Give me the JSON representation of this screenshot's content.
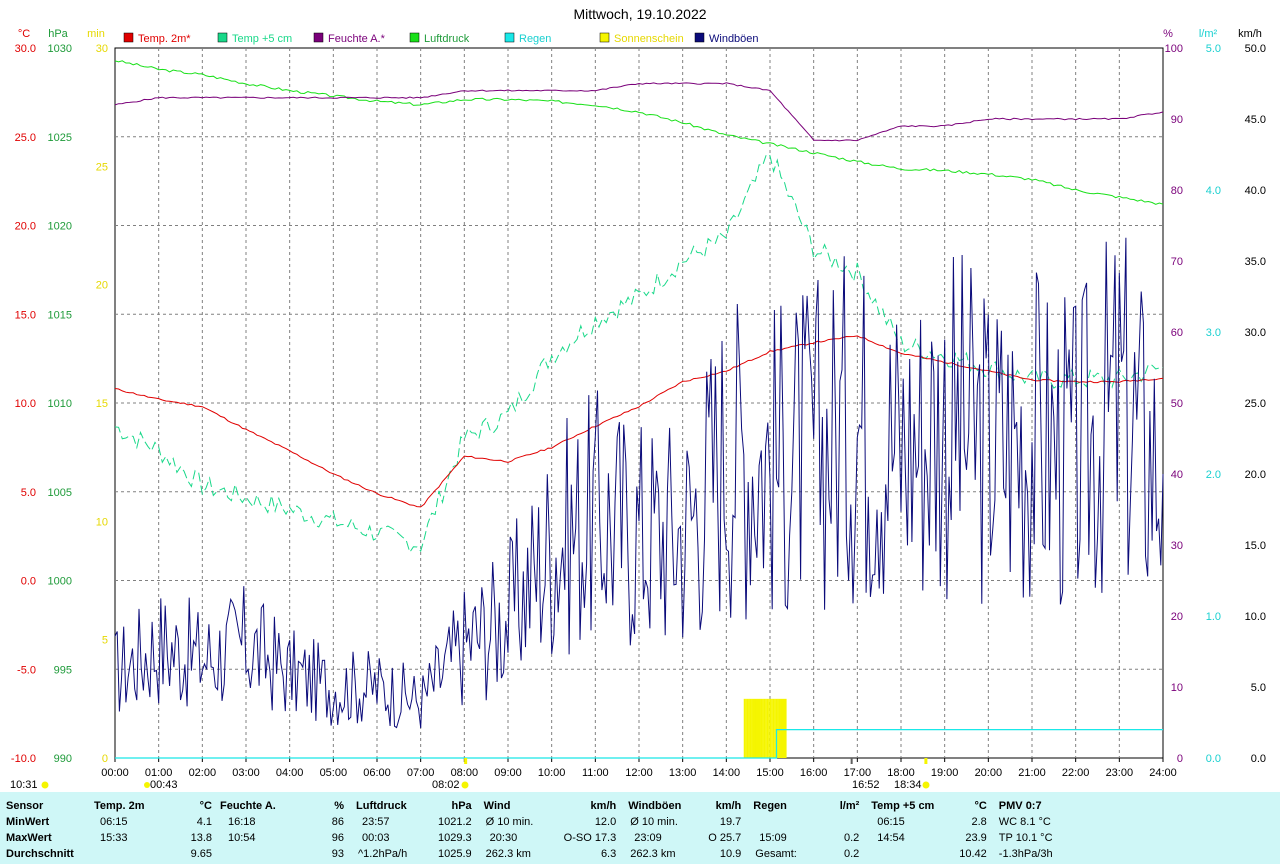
{
  "title": "Mittwoch, 19.10.2022",
  "colors": {
    "temp2m": "#e00000",
    "temp5cm": "#19d889",
    "humidity": "#7a007a",
    "pressure": "#19e019",
    "rain": "#19e8e8",
    "sun": "#f5f500",
    "gusts": "#0b0b7a",
    "grid": "#808080",
    "pressure_label": "#1f9b3a",
    "sun_label": "#e6d800",
    "humidity_label": "#7a007a",
    "rain_label": "#19d0d0"
  },
  "legend": [
    {
      "label": "Temp. 2m*",
      "color": "#e00000"
    },
    {
      "label": "Temp +5 cm",
      "color": "#19d889"
    },
    {
      "label": "Feuchte A.*",
      "color": "#7a007a"
    },
    {
      "label": "Luftdruck",
      "color": "#19e019"
    },
    {
      "label": "Regen",
      "color": "#19e8e8"
    },
    {
      "label": "Sonnenschein",
      "color": "#f5f500"
    },
    {
      "label": "Windböen",
      "color": "#0b0b7a"
    }
  ],
  "axes": {
    "temp_unit": "°C",
    "pressure_unit": "hPa",
    "sun_unit": "min",
    "humidity_unit": "%",
    "rain_unit": "l/m²",
    "wind_unit": "km/h",
    "temp_ticks": [
      "30.0",
      "25.0",
      "20.0",
      "15.0",
      "10.0",
      "5.0",
      "0.0",
      "-5.0",
      "-10.0"
    ],
    "pressure_ticks": [
      "1030",
      "1025",
      "1020",
      "1015",
      "1010",
      "1005",
      "1000",
      "995",
      "990"
    ],
    "sun_ticks": [
      "30",
      "25",
      "20",
      "15",
      "10",
      "5",
      "0"
    ],
    "humidity_ticks": [
      "100",
      "90",
      "80",
      "70",
      "60",
      "50",
      "40",
      "30",
      "20",
      "10",
      "0"
    ],
    "rain_ticks": [
      "5.0",
      "4.0",
      "3.0",
      "2.0",
      "1.0",
      "0.0"
    ],
    "wind_ticks": [
      "50.0",
      "45.0",
      "40.0",
      "35.0",
      "30.0",
      "25.0",
      "20.0",
      "15.0",
      "10.0",
      "5.0",
      "0.0"
    ],
    "time_ticks": [
      "00:00",
      "01:00",
      "02:00",
      "03:00",
      "04:00",
      "05:00",
      "06:00",
      "07:00",
      "08:00",
      "09:00",
      "10:00",
      "11:00",
      "12:00",
      "13:00",
      "14:00",
      "15:00",
      "16:00",
      "17:00",
      "18:00",
      "19:00",
      "20:00",
      "21:00",
      "22:00",
      "23:00",
      "24:00"
    ]
  },
  "annotations": {
    "sunrise_prev": "10:31",
    "moon": "00:43",
    "sunrise": "08:02",
    "moonset": "16:52",
    "sunset": "18:34"
  },
  "chart_data": {
    "type": "line",
    "title": "Mittwoch, 19.10.2022",
    "x": [
      0,
      1,
      2,
      3,
      4,
      5,
      6,
      7,
      8,
      9,
      10,
      11,
      12,
      13,
      14,
      15,
      16,
      17,
      18,
      19,
      20,
      21,
      22,
      23,
      24
    ],
    "xlabel": "",
    "series": [
      {
        "name": "Temp. 2m*",
        "axis": "°C",
        "values": [
          10.8,
          10.2,
          9.8,
          8.5,
          7.3,
          6.0,
          4.9,
          4.1,
          7.0,
          6.7,
          7.5,
          8.7,
          9.8,
          11.2,
          11.8,
          12.9,
          13.4,
          13.8,
          12.8,
          12.3,
          11.8,
          11.3,
          11.2,
          11.2,
          11.4
        ]
      },
      {
        "name": "Temp +5 cm",
        "axis": "min",
        "values": [
          14,
          13,
          11.5,
          11,
          10.5,
          10,
          9.5,
          9,
          13.5,
          14.5,
          17,
          18.5,
          19.5,
          21,
          22,
          25.5,
          21.5,
          20.5,
          17.5,
          17,
          16.5,
          16,
          16,
          16,
          16.5
        ]
      },
      {
        "name": "Feuchte A.*",
        "axis": "%",
        "values": [
          92,
          93,
          93,
          93,
          93,
          93,
          93,
          93,
          94,
          94,
          94,
          94,
          95,
          95,
          95,
          94,
          87,
          87,
          89,
          89,
          90,
          90,
          90,
          90,
          91
        ]
      },
      {
        "name": "Luftdruck",
        "axis": "hPa",
        "values": [
          1029.3,
          1028.8,
          1028.5,
          1028.0,
          1027.6,
          1027.3,
          1027.0,
          1026.8,
          1027.1,
          1027.1,
          1027.0,
          1026.8,
          1026.4,
          1025.8,
          1025.1,
          1024.6,
          1024.1,
          1023.6,
          1023.2,
          1023.1,
          1022.9,
          1022.6,
          1022.0,
          1021.6,
          1021.2
        ]
      },
      {
        "name": "Regen",
        "axis": "l/m²",
        "values": [
          0,
          0,
          0,
          0,
          0,
          0,
          0,
          0,
          0,
          0,
          0,
          0,
          0,
          0,
          0,
          0.2,
          0.2,
          0.2,
          0.2,
          0.2,
          0.2,
          0.2,
          0.2,
          0.2,
          0.2
        ]
      },
      {
        "name": "Windböen",
        "axis": "km/h",
        "values": [
          6,
          8,
          7,
          8,
          6,
          5,
          5,
          4,
          8,
          10,
          15,
          17,
          16,
          16,
          22,
          21,
          22,
          24,
          22,
          24,
          22,
          23,
          21,
          25,
          20
        ]
      }
    ],
    "sunshine_window": [
      "14:25",
      "15:22"
    ],
    "ylim_temp": [
      -10,
      30
    ],
    "ylim_pressure": [
      990,
      1030
    ],
    "ylim_humidity": [
      0,
      100
    ],
    "ylim_rain": [
      0,
      5
    ],
    "ylim_wind": [
      0,
      50
    ],
    "grid": true,
    "legend_position": "top"
  },
  "stats": {
    "headers": {
      "sensor": "Sensor",
      "temp2m": "Temp. 2m",
      "temp2m_unit": "°C",
      "hum": "Feuchte A.",
      "hum_unit": "%",
      "pres": "Luftdruck",
      "pres_unit": "hPa",
      "wind": "Wind",
      "wind_unit": "km/h",
      "gust": "Windböen",
      "gust_unit": "km/h",
      "rain": "Regen",
      "rain_unit": "l/m²",
      "t5": "Temp +5 cm",
      "t5_unit": "°C",
      "pmv": "PMV 0:7"
    },
    "min": {
      "label": "MinWert",
      "temp2m_time": "06:15",
      "temp2m_val": "4.1",
      "hum_time": "16:18",
      "hum_val": "86",
      "pres_time": "23:57",
      "pres_val": "1021.2",
      "wind_desc": "Ø 10 min.",
      "wind_val": "12.0",
      "gust_desc": "Ø 10 min.",
      "gust_val": "19.7",
      "rain_time": "",
      "rain_val": "",
      "t5_time": "06:15",
      "t5_val": "2.8",
      "pmv": "WC 8.1 °C"
    },
    "max": {
      "label": "MaxWert",
      "temp2m_time": "15:33",
      "temp2m_val": "13.8",
      "hum_time": "10:54",
      "hum_val": "96",
      "pres_time": "00:03",
      "pres_val": "1029.3",
      "wind_time": "20:30",
      "wind_val": "O-SO 17.3",
      "gust_time": "23:09",
      "gust_val": "O 25.7",
      "rain_time": "15:09",
      "rain_val": "0.2",
      "t5_time": "14:54",
      "t5_val": "23.9",
      "pmv": "TP 10.1 °C"
    },
    "avg": {
      "label": "Durchschnitt",
      "temp2m_val": "9.65",
      "hum_val": "93",
      "pres_trend": "^1.2hPa/h",
      "pres_val": "1025.9",
      "wind_dist": "262.3 km",
      "wind_val": "6.3",
      "gust_dist": "262.3 km",
      "gust_val": "10.9",
      "rain_label": "Gesamt:",
      "rain_val": "0.2",
      "t5_val": "10.42",
      "pmv": "-1.3hPa/3h"
    }
  }
}
